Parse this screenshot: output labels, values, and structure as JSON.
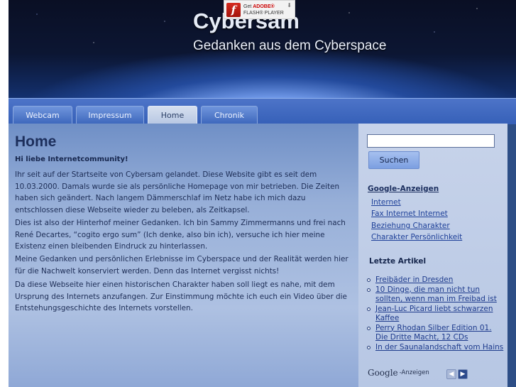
{
  "header": {
    "title": "Cybersam",
    "subtitle": "Gedanken aus dem Cyberspace",
    "flash": {
      "get": "Get ",
      "adobe": "ADOBE®",
      "player": "FLASH® PLAYER",
      "logo": "f"
    }
  },
  "nav": {
    "tabs": [
      {
        "label": "Webcam"
      },
      {
        "label": "Impressum"
      },
      {
        "label": "Home"
      },
      {
        "label": "Chronik"
      }
    ],
    "active": "Home"
  },
  "main": {
    "title": "Home",
    "greeting": "Hi liebe Internetcommunity!",
    "paragraphs": [
      "Ihr seit auf der Startseite von Cybersam gelandet. Diese Website gibt es seit dem 10.03.2000. Damals wurde sie als persönliche Homepage von mir betrieben. Die Zeiten haben sich geändert. Nach langem Dämmerschlaf im Netz habe ich mich dazu entschlossen diese Webseite wieder zu beleben, als Zeitkapsel.",
      "Dies ist also der Hinterhof meiner Gedanken. Ich bin Sammy Zimmermanns und frei nach René Decartes, “cogito ergo sum” (Ich denke, also bin ich), versuche ich hier meine Existenz einen bleibenden Eindruck zu hinterlassen.",
      "Meine Gedanken und persönlichen Erlebnisse im Cyberspace und der Realität werden hier für die Nachwelt konserviert werden. Denn das Internet vergisst nichts!",
      "Da diese Webseite hier einen historischen Charakter haben soll liegt es nahe, mit dem Ursprung des Internets anzufangen. Zur Einstimmung möchte ich euch ein Video über die Entstehungsgeschichte des Internets vorstellen."
    ]
  },
  "sidebar": {
    "search": {
      "value": "",
      "button": "Suchen"
    },
    "ads": {
      "heading": "Google-Anzeigen",
      "links": [
        "Internet",
        "Fax Internet Internet",
        "Beziehung Charakter",
        "Charakter Persönlichkeit"
      ]
    },
    "articles": {
      "heading": "Letzte Artikel",
      "items": [
        "Freibäder in Dresden",
        "10 Dinge, die man nicht tun sollten, wenn man im Freibad ist",
        "Jean-Luc Picard liebt schwarzen Kaffee",
        "Perry Rhodan Silber Edition 01. Die Dritte Macht, 12 CDs",
        "In der Saunalandschaft vom Hains"
      ]
    },
    "footer": {
      "google": "Google",
      "suffix": "-Anzeigen",
      "prev": "◀",
      "next": "▶"
    }
  }
}
